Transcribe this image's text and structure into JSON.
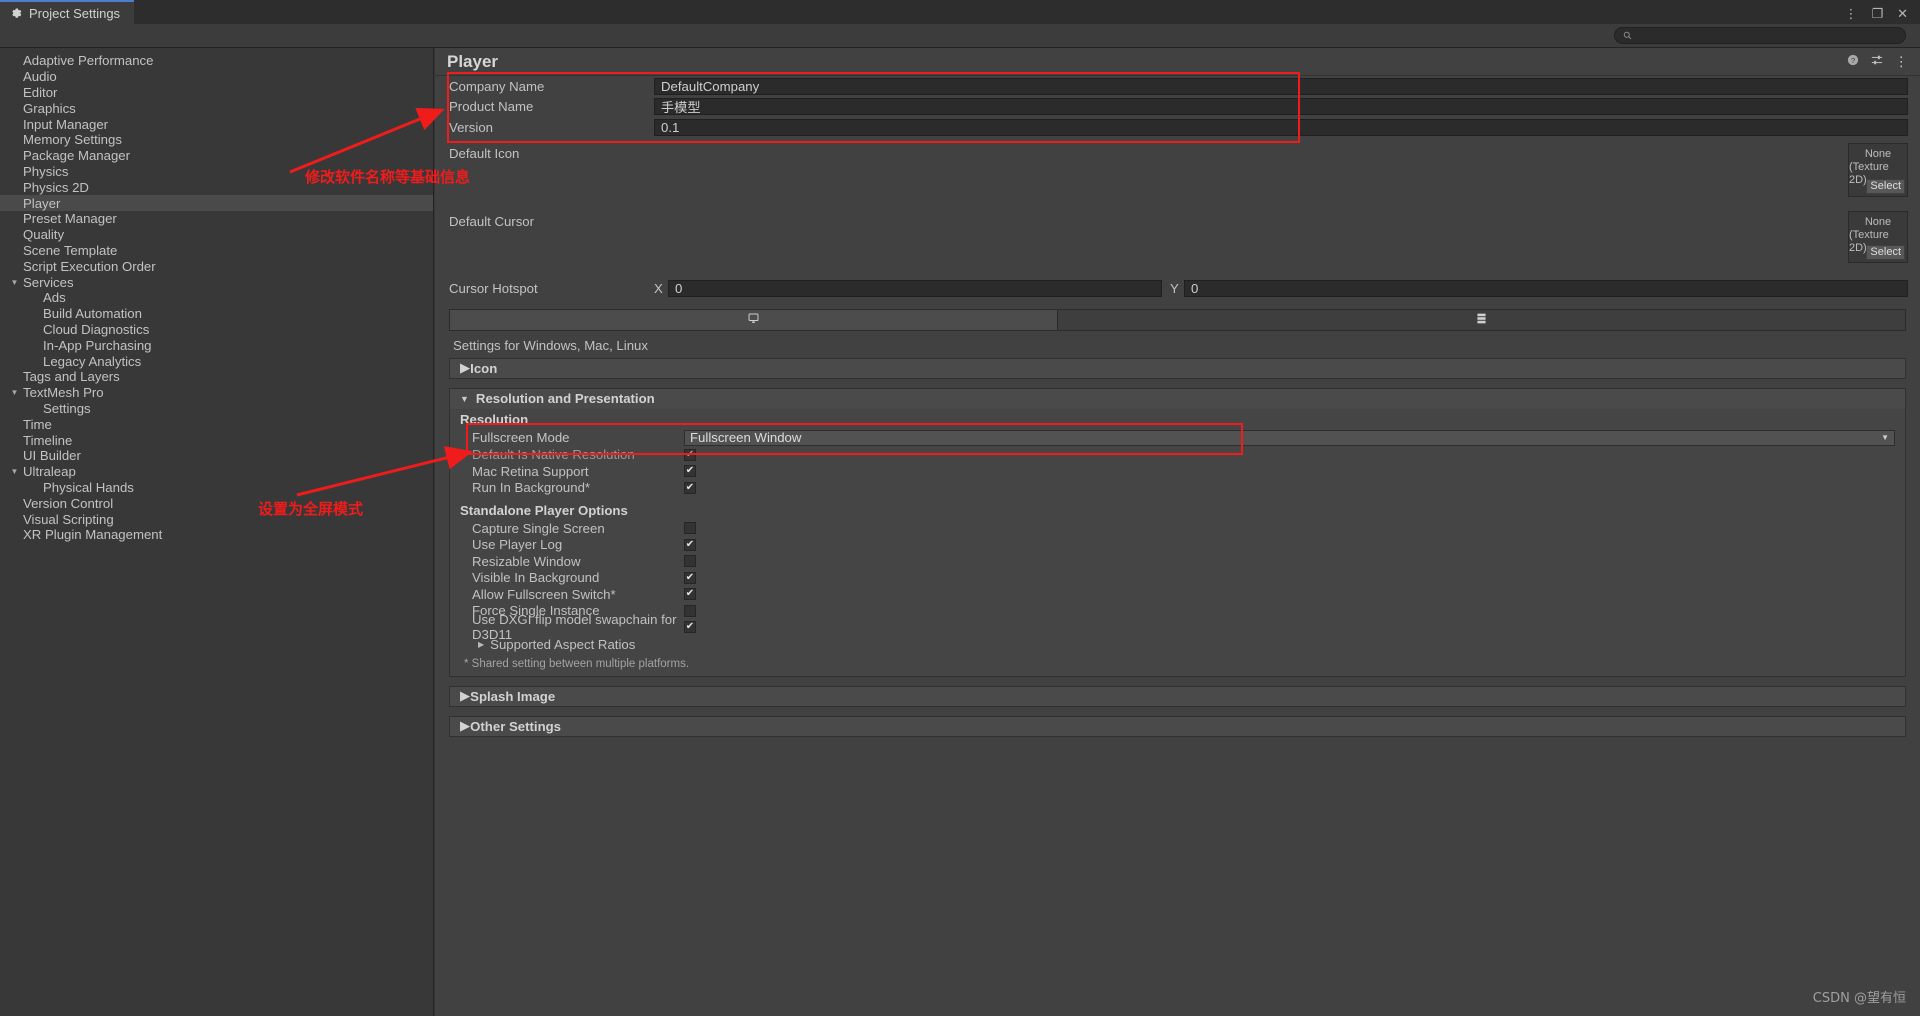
{
  "window": {
    "tab_label": "Project Settings",
    "tab_icon": "gear-icon",
    "controls": [
      "more-vertical-icon",
      "maximize-icon",
      "close-icon"
    ]
  },
  "search": {
    "placeholder": "",
    "value": "",
    "icon": "search-icon"
  },
  "sidebar": {
    "items": [
      {
        "label": "Adaptive Performance",
        "indent": 0,
        "twisty": "",
        "selected": false
      },
      {
        "label": "Audio",
        "indent": 0,
        "twisty": "",
        "selected": false
      },
      {
        "label": "Editor",
        "indent": 0,
        "twisty": "",
        "selected": false
      },
      {
        "label": "Graphics",
        "indent": 0,
        "twisty": "",
        "selected": false
      },
      {
        "label": "Input Manager",
        "indent": 0,
        "twisty": "",
        "selected": false
      },
      {
        "label": "Memory Settings",
        "indent": 0,
        "twisty": "",
        "selected": false
      },
      {
        "label": "Package Manager",
        "indent": 0,
        "twisty": "",
        "selected": false
      },
      {
        "label": "Physics",
        "indent": 0,
        "twisty": "",
        "selected": false
      },
      {
        "label": "Physics 2D",
        "indent": 0,
        "twisty": "",
        "selected": false
      },
      {
        "label": "Player",
        "indent": 0,
        "twisty": "",
        "selected": true
      },
      {
        "label": "Preset Manager",
        "indent": 0,
        "twisty": "",
        "selected": false
      },
      {
        "label": "Quality",
        "indent": 0,
        "twisty": "",
        "selected": false
      },
      {
        "label": "Scene Template",
        "indent": 0,
        "twisty": "",
        "selected": false
      },
      {
        "label": "Script Execution Order",
        "indent": 0,
        "twisty": "",
        "selected": false
      },
      {
        "label": "Services",
        "indent": 0,
        "twisty": "▼",
        "selected": false
      },
      {
        "label": "Ads",
        "indent": 1,
        "twisty": "",
        "selected": false
      },
      {
        "label": "Build Automation",
        "indent": 1,
        "twisty": "",
        "selected": false
      },
      {
        "label": "Cloud Diagnostics",
        "indent": 1,
        "twisty": "",
        "selected": false
      },
      {
        "label": "In-App Purchasing",
        "indent": 1,
        "twisty": "",
        "selected": false
      },
      {
        "label": "Legacy Analytics",
        "indent": 1,
        "twisty": "",
        "selected": false
      },
      {
        "label": "Tags and Layers",
        "indent": 0,
        "twisty": "",
        "selected": false
      },
      {
        "label": "TextMesh Pro",
        "indent": 0,
        "twisty": "▼",
        "selected": false
      },
      {
        "label": "Settings",
        "indent": 1,
        "twisty": "",
        "selected": false
      },
      {
        "label": "Time",
        "indent": 0,
        "twisty": "",
        "selected": false
      },
      {
        "label": "Timeline",
        "indent": 0,
        "twisty": "",
        "selected": false
      },
      {
        "label": "UI Builder",
        "indent": 0,
        "twisty": "",
        "selected": false
      },
      {
        "label": "Ultraleap",
        "indent": 0,
        "twisty": "▼",
        "selected": false
      },
      {
        "label": "Physical Hands",
        "indent": 1,
        "twisty": "",
        "selected": false
      },
      {
        "label": "Version Control",
        "indent": 0,
        "twisty": "",
        "selected": false
      },
      {
        "label": "Visual Scripting",
        "indent": 0,
        "twisty": "",
        "selected": false
      },
      {
        "label": "XR Plugin Management",
        "indent": 0,
        "twisty": "",
        "selected": false
      }
    ]
  },
  "inspector": {
    "title": "Player",
    "header_icons": [
      "help-icon",
      "preset-icon",
      "more-vertical-icon"
    ],
    "fields": [
      {
        "label": "Company Name",
        "value": "DefaultCompany"
      },
      {
        "label": "Product Name",
        "value": "手模型"
      },
      {
        "label": "Version",
        "value": "0.1"
      }
    ],
    "default_icon": {
      "label": "Default Icon",
      "object_name": "None",
      "object_type": "(Texture 2D)",
      "select_label": "Select"
    },
    "default_cursor": {
      "label": "Default Cursor",
      "object_name": "None",
      "object_type": "(Texture 2D)",
      "select_label": "Select"
    },
    "cursor_hotspot": {
      "label": "Cursor Hotspot",
      "x_axis": "X",
      "x_value": "0",
      "y_axis": "Y",
      "y_value": "0"
    },
    "platform_tabs": [
      {
        "icon": "desktop-icon",
        "active": true
      },
      {
        "icon": "server-icon",
        "active": false
      }
    ],
    "settings_for": "Settings for Windows, Mac, Linux",
    "sections": {
      "icon": {
        "label": "Icon",
        "arrow": "▶",
        "expanded": false
      },
      "resolution": {
        "label": "Resolution and Presentation",
        "arrow": "▼",
        "expanded": true,
        "group_resolution": "Resolution",
        "fullscreen_mode": {
          "label": "Fullscreen Mode",
          "value": "Fullscreen Window",
          "caret": "▼"
        },
        "checkboxes": [
          {
            "label": "Default Is Native Resolution",
            "checked": true,
            "dim": true
          },
          {
            "label": "Mac Retina Support",
            "checked": true,
            "dim": false
          },
          {
            "label": "Run In Background*",
            "checked": true,
            "dim": false
          }
        ],
        "group_standalone": "Standalone Player Options",
        "standalone_checkboxes": [
          {
            "label": "Capture Single Screen",
            "checked": false,
            "dim": false
          },
          {
            "label": "Use Player Log",
            "checked": true,
            "dim": false
          },
          {
            "label": "Resizable Window",
            "checked": false,
            "dim": false
          },
          {
            "label": "Visible In Background",
            "checked": true,
            "dim": false
          },
          {
            "label": "Allow Fullscreen Switch*",
            "checked": true,
            "dim": false
          },
          {
            "label": "Force Single Instance",
            "checked": false,
            "dim": false
          },
          {
            "label": "Use DXGI flip model swapchain for D3D11",
            "checked": true,
            "dim": false
          }
        ],
        "supported_aspect_ratios": {
          "label": "Supported Aspect Ratios",
          "arrow": "▶"
        },
        "footnote": "* Shared setting between multiple platforms."
      },
      "splash": {
        "label": "Splash Image",
        "arrow": "▶",
        "expanded": false
      },
      "other": {
        "label": "Other Settings",
        "arrow": "▶",
        "expanded": false
      }
    }
  },
  "annotations": {
    "note_1": "修改软件名称等基础信息",
    "note_2": "设置为全屏模式",
    "color": "#f01c1c"
  },
  "watermark": "CSDN @望有恒"
}
